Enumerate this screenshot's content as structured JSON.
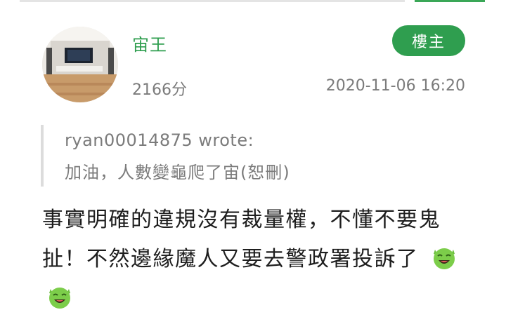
{
  "post": {
    "username": "宙王",
    "badge": "樓主",
    "score": "2166分",
    "timestamp": "2020-11-06 16:20",
    "quote": {
      "author": "ryan00014875 wrote:",
      "text": "加油，人數變龜爬了宙(恕刪)"
    },
    "body_text": "事實明確的違規沒有裁量權，不懂不要鬼扯！不然邊緣魔人又要去警政署投訴了",
    "emojis": [
      "green-devil-laughing-emoji",
      "green-devil-laughing-emoji"
    ]
  },
  "colors": {
    "accent": "#2f9e4f",
    "muted_text": "#7b7b7b",
    "quote_bar": "#dcdcdc"
  }
}
